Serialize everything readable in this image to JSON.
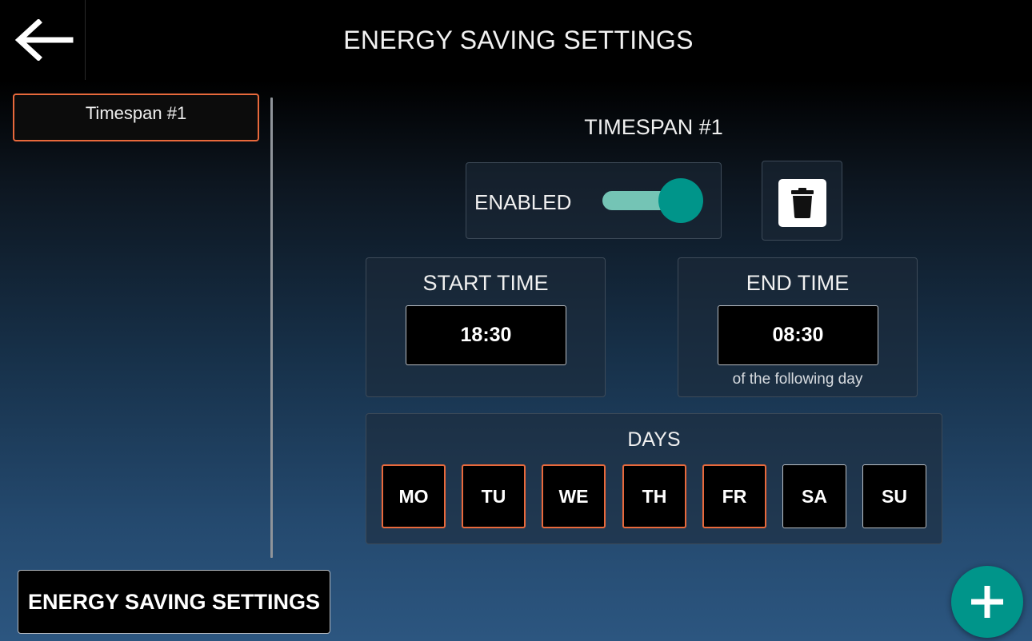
{
  "header": {
    "title": "ENERGY SAVING SETTINGS",
    "back_icon": "arrow-left-icon"
  },
  "sidebar": {
    "items": [
      {
        "label": "Timespan #1",
        "selected": true
      }
    ]
  },
  "timespan": {
    "title": "TIMESPAN #1",
    "enabled_label": "ENABLED",
    "enabled": true,
    "delete_icon": "trash-icon",
    "start": {
      "label": "START TIME",
      "value": "18:30"
    },
    "end": {
      "label": "END TIME",
      "value": "08:30",
      "note": "of the following day"
    },
    "days": {
      "label": "DAYS",
      "items": [
        {
          "label": "MO",
          "active": true
        },
        {
          "label": "TU",
          "active": true
        },
        {
          "label": "WE",
          "active": true
        },
        {
          "label": "TH",
          "active": true
        },
        {
          "label": "FR",
          "active": true
        },
        {
          "label": "SA",
          "active": false
        },
        {
          "label": "SU",
          "active": false
        }
      ]
    }
  },
  "footer": {
    "button_label": "ENERGY SAVING SETTINGS",
    "add_icon": "plus-icon"
  },
  "colors": {
    "accent": "#e8693c",
    "toggle_knob": "#00958a",
    "toggle_track": "#74c4b5",
    "fab": "#00958a"
  }
}
